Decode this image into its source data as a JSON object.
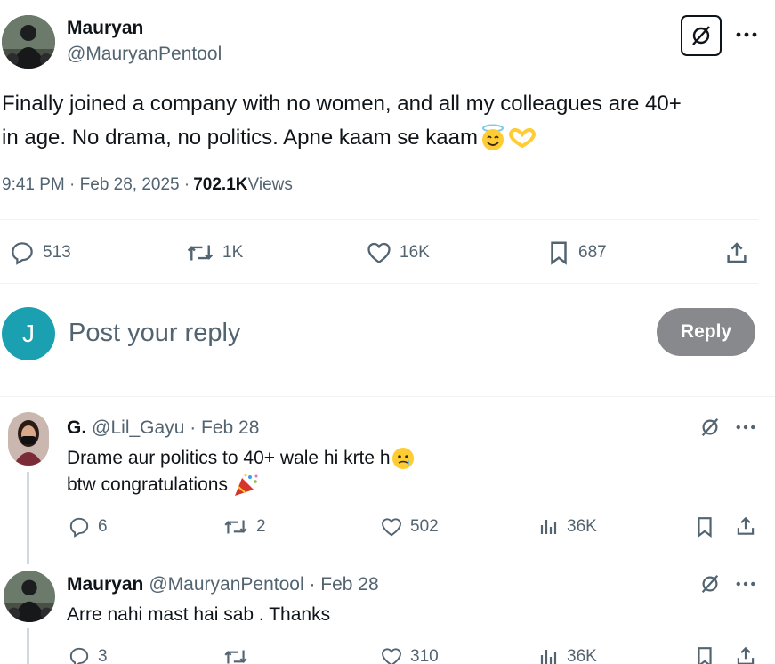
{
  "tweet": {
    "author_name": "Mauryan",
    "author_handle": "@MauryanPentool",
    "text_line1": "Finally joined a company with no women, and all my colleagues are 40+",
    "text_line2": "in age. No drama, no politics. Apne kaam se kaam",
    "emoji_1": "halo-smile-emoji",
    "emoji_2": "heart-hands-emoji",
    "time": "9:41 PM · Feb 28, 2025 · ",
    "views_count": "702.1K",
    "views_label": " Views",
    "stats": {
      "replies": "513",
      "reposts": "1K",
      "likes": "16K",
      "bookmarks": "687"
    }
  },
  "composer": {
    "avatar_letter": "J",
    "placeholder": "Post your reply",
    "button_label": "Reply",
    "avatar_color": "#1d9bf0"
  },
  "replies": [
    {
      "name": "G.",
      "handle_date": "@Lil_Gayu · Feb 28",
      "line1": "Drame aur politics to 40+ wale hi krte h",
      "line2": "btw congratulations",
      "replies": "6",
      "reposts": "2",
      "likes": "502",
      "views": "36K"
    },
    {
      "name": "Mauryan",
      "handle_date": "@MauryanPentool · Feb 28",
      "line1": "Arre nahi mast hai sab . Thanks",
      "replies": "3",
      "reposts": "",
      "likes": "310",
      "views": "36K"
    }
  ],
  "colors": {
    "text": "#0f1419",
    "muted": "#536471",
    "reply_button": "#87898c",
    "divider": "#eff3f4"
  }
}
